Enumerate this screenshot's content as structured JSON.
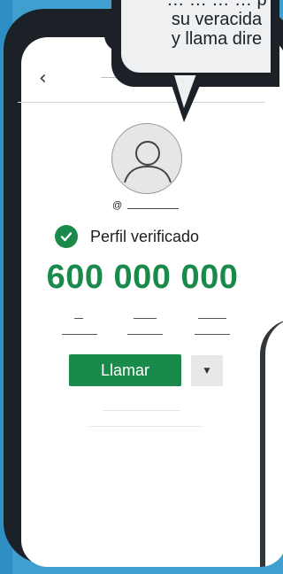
{
  "bubble": {
    "lines": [
      "… … … … p",
      "su veracida",
      "y llama dire"
    ]
  },
  "header": {
    "back_icon": "chevron-left-icon"
  },
  "profile": {
    "handle_prefix": "@",
    "verified": {
      "icon": "check-circle-icon",
      "label": "Perfil verificado"
    },
    "phone_number": "600 000 000"
  },
  "actions": {
    "call_label": "Llamar",
    "menu_icon": "caret-down-icon"
  },
  "colors": {
    "accent": "#1a8a4a",
    "background": "#3f9fcf",
    "frame": "#1b2126"
  }
}
